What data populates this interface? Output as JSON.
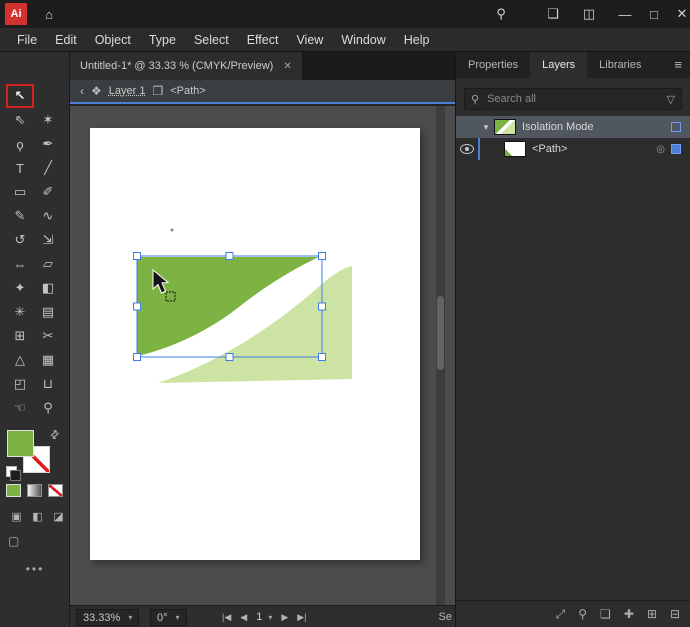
{
  "colors": {
    "accent_blue": "#4b7fd6",
    "selection_blue": "#3f7ee8",
    "shape_green_dark": "#7cb342",
    "shape_green_light": "#cde3a4",
    "tool_highlight_red": "#d2231e",
    "layer_selected_bg": "#50575f",
    "artboard_white": "#ffffff"
  },
  "titlebar": {
    "app_icon_label": "Ai",
    "home_icon": "⌂",
    "search_icon": "⚲",
    "workspace_icon": "❑",
    "layout_icon": "◫",
    "minimize_icon": "—",
    "maximize_icon": "□",
    "close_icon": "✕"
  },
  "menubar": {
    "items": [
      "File",
      "Edit",
      "Object",
      "Type",
      "Select",
      "Effect",
      "View",
      "Window",
      "Help"
    ]
  },
  "document_tab": {
    "title": "Untitled-1* @ 33.33 % (CMYK/Preview)",
    "close_icon": "✕"
  },
  "controlbar": {
    "back_icon": "‹",
    "layers_icon": "❖",
    "layer_label": "Layer 1",
    "folder_icon": "❐",
    "path_label": "<Path>"
  },
  "toolbar": {
    "tools": [
      {
        "name": "selection",
        "glyph": "↖"
      },
      {
        "name": "direct-selection",
        "glyph": "⇖"
      },
      {
        "name": "magic-wand",
        "glyph": "✶"
      },
      {
        "name": "lasso",
        "glyph": "ϙ"
      },
      {
        "name": "pen",
        "glyph": "✒"
      },
      {
        "name": "type",
        "glyph": "T"
      },
      {
        "name": "line-segment",
        "glyph": "╱"
      },
      {
        "name": "rectangle",
        "glyph": "▭"
      },
      {
        "name": "paintbrush",
        "glyph": "✐"
      },
      {
        "name": "pencil",
        "glyph": "✎"
      },
      {
        "name": "shaper",
        "glyph": "∿"
      },
      {
        "name": "rotate",
        "glyph": "↺"
      },
      {
        "name": "scale",
        "glyph": "⇲"
      },
      {
        "name": "width",
        "glyph": "⇔"
      },
      {
        "name": "free-transform",
        "glyph": "▱"
      },
      {
        "name": "eyedropper",
        "glyph": "✦"
      },
      {
        "name": "blend",
        "glyph": "◧"
      },
      {
        "name": "symbol-sprayer",
        "glyph": "✳"
      },
      {
        "name": "column-graph",
        "glyph": "▤"
      },
      {
        "name": "artboard",
        "glyph": "⊞"
      },
      {
        "name": "slice",
        "glyph": "✂"
      },
      {
        "name": "perspective-grid",
        "glyph": "△"
      },
      {
        "name": "mesh",
        "glyph": "▦"
      },
      {
        "name": "shape-builder",
        "glyph": "◰"
      },
      {
        "name": "live-paint-bucket",
        "glyph": "⊔"
      },
      {
        "name": "hand",
        "glyph": "☜"
      },
      {
        "name": "zoom",
        "glyph": "⚲"
      }
    ],
    "fill_color": "#7cb342",
    "stroke_value": "none",
    "swap_icon": "⇄",
    "drawing_modes": [
      "▣",
      "◧",
      "◪"
    ],
    "screen_mode_icon": "▢",
    "more_icon": "•••"
  },
  "layers_panel": {
    "tabs": [
      {
        "label": "Properties"
      },
      {
        "label": "Layers"
      },
      {
        "label": "Libraries"
      }
    ],
    "active_tab": "Layers",
    "menu_icon": "≡",
    "search": {
      "icon": "⚲",
      "placeholder": "Search all",
      "filter_icon": "▽"
    },
    "rows": [
      {
        "expand_icon": "▾",
        "label": "Isolation Mode"
      },
      {
        "label": "<Path>",
        "target_icon": "◎"
      }
    ],
    "bottom_icons": [
      {
        "name": "collect-export",
        "glyph": "⤢"
      },
      {
        "name": "locate-object",
        "glyph": "⚲"
      },
      {
        "name": "clipping-mask",
        "glyph": "❏"
      },
      {
        "name": "new-sublayer",
        "glyph": "✚"
      },
      {
        "name": "new-layer",
        "glyph": "⊞"
      },
      {
        "name": "delete",
        "glyph": "⊟"
      }
    ]
  },
  "statusbar": {
    "zoom": "33.33%",
    "chevron": "▾",
    "rotation": "0°",
    "nav_first": "|◀",
    "nav_prev": "◀",
    "artboard_number": "1",
    "nav_next": "▶",
    "nav_last": "▶|",
    "trailing": "Se"
  }
}
